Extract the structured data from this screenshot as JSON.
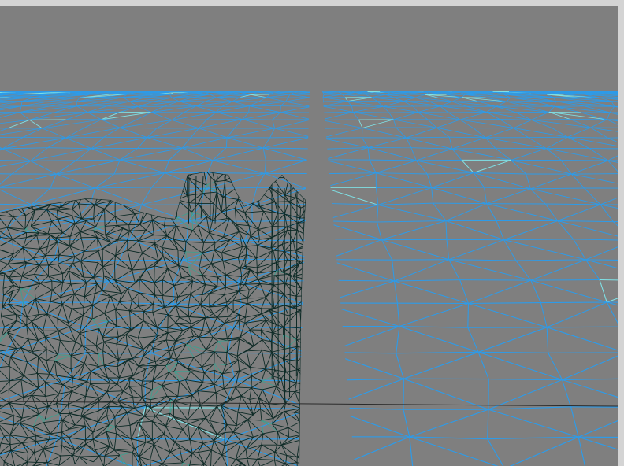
{
  "scene": {
    "background_color": "#7f7f7f",
    "frame_color": "#d4d4d4",
    "water_mesh_color": "#2e9be8",
    "water_highlight_color": "#7fe3e8",
    "terrain_mesh_color": "#0d2a26",
    "terrain_highlight_color": "#3f9f8f",
    "horizon_line_color": "#2a2a2a"
  }
}
